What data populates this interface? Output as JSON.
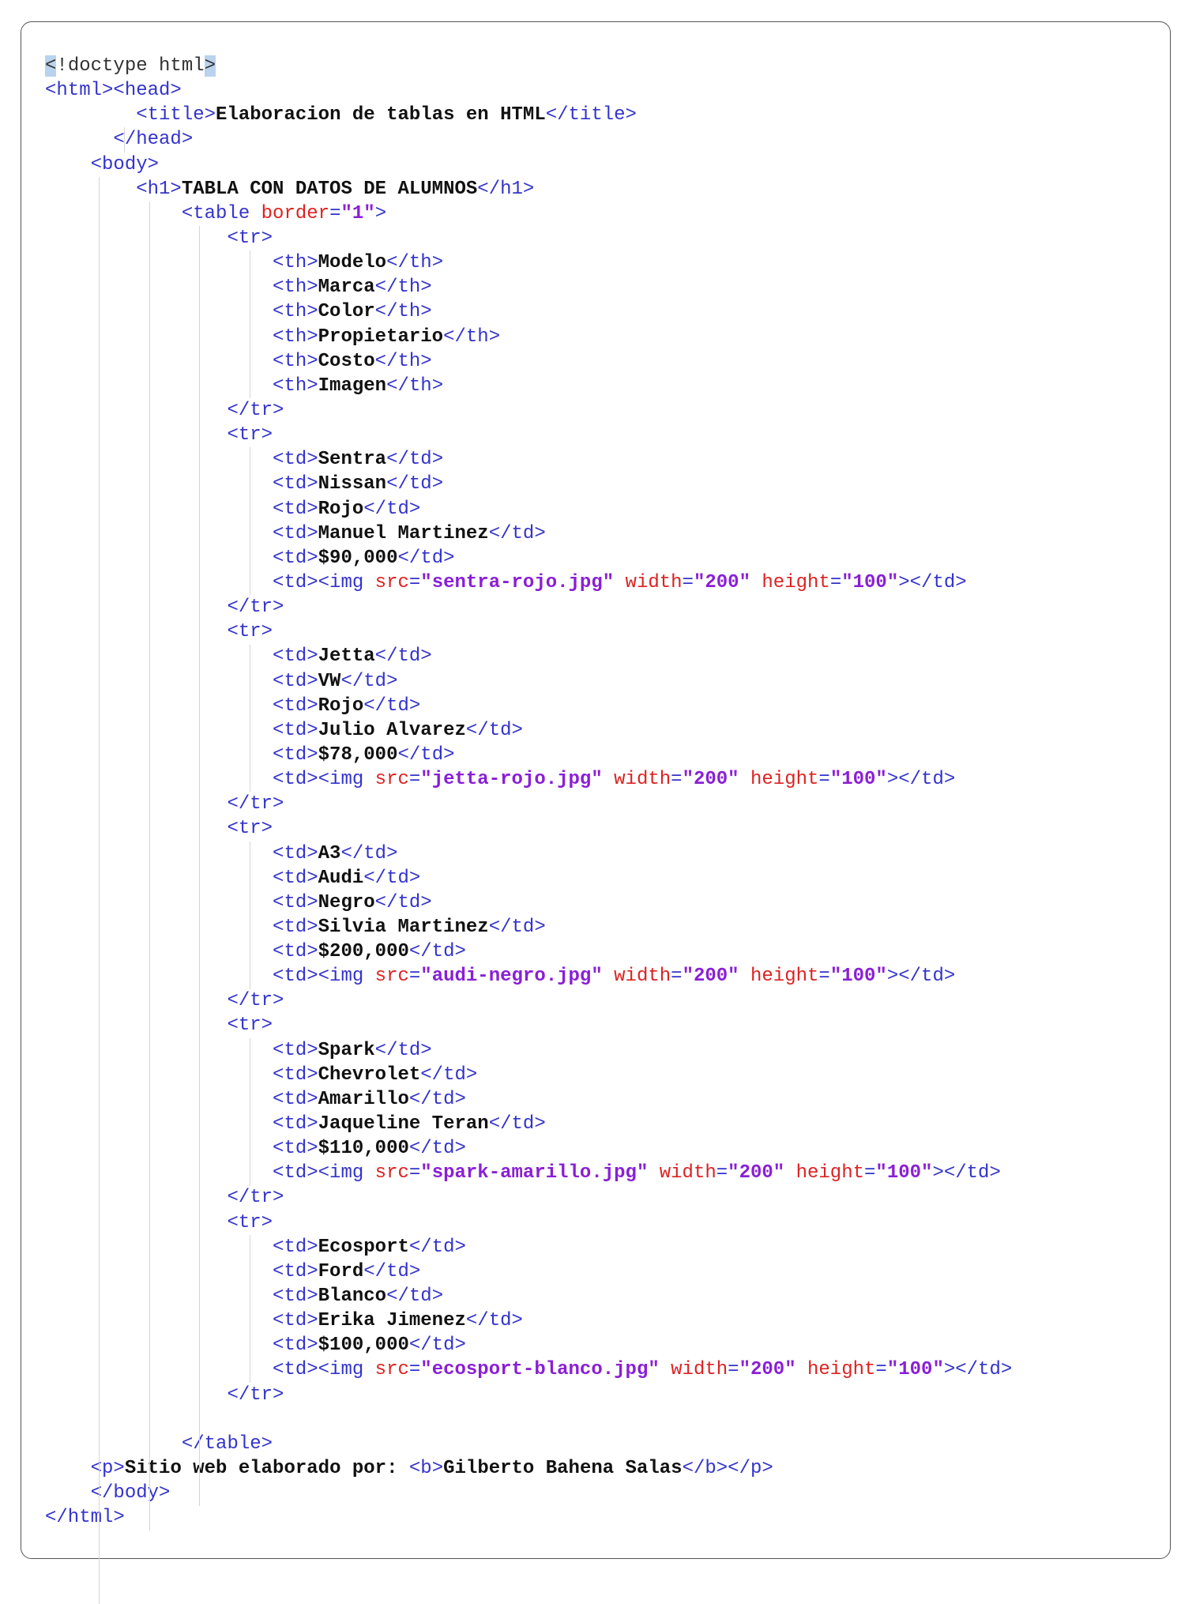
{
  "editor": {
    "lines": [
      {
        "indent": 0,
        "parts": [
          {
            "t": "<",
            "c": "hl"
          },
          {
            "t": "!",
            "c": "hl-plain"
          },
          {
            "t": "doctype html",
            "c": "plain"
          },
          {
            "t": ">",
            "c": "hl"
          }
        ]
      },
      {
        "indent": 0,
        "parts": [
          {
            "t": "<html><head>",
            "c": "tag"
          }
        ]
      },
      {
        "indent": 8,
        "parts": [
          {
            "t": "<title>",
            "c": "tag"
          },
          {
            "t": "Elaboracion de tablas en HTML",
            "c": "txt"
          },
          {
            "t": "</title>",
            "c": "tag"
          }
        ]
      },
      {
        "indent": 6,
        "parts": [
          {
            "t": "</head>",
            "c": "tag"
          }
        ]
      },
      {
        "indent": 4,
        "parts": [
          {
            "t": "<body>",
            "c": "tag"
          }
        ]
      },
      {
        "indent": 8,
        "parts": [
          {
            "t": "<h1>",
            "c": "tag"
          },
          {
            "t": "TABLA CON DATOS DE ALUMNOS",
            "c": "txt"
          },
          {
            "t": "</h1>",
            "c": "tag"
          }
        ]
      },
      {
        "indent": 12,
        "parts": [
          {
            "t": "<table ",
            "c": "tag"
          },
          {
            "t": "border",
            "c": "attr"
          },
          {
            "t": "=",
            "c": "tag"
          },
          {
            "t": "\"1\"",
            "c": "val"
          },
          {
            "t": ">",
            "c": "tag"
          }
        ]
      },
      {
        "indent": 16,
        "parts": [
          {
            "t": "<tr>",
            "c": "tag"
          }
        ]
      },
      {
        "indent": 20,
        "parts": [
          {
            "t": "<th>",
            "c": "tag"
          },
          {
            "t": "Modelo",
            "c": "txt"
          },
          {
            "t": "</th>",
            "c": "tag"
          }
        ]
      },
      {
        "indent": 20,
        "parts": [
          {
            "t": "<th>",
            "c": "tag"
          },
          {
            "t": "Marca",
            "c": "txt"
          },
          {
            "t": "</th>",
            "c": "tag"
          }
        ]
      },
      {
        "indent": 20,
        "parts": [
          {
            "t": "<th>",
            "c": "tag"
          },
          {
            "t": "Color",
            "c": "txt"
          },
          {
            "t": "</th>",
            "c": "tag"
          }
        ]
      },
      {
        "indent": 20,
        "parts": [
          {
            "t": "<th>",
            "c": "tag"
          },
          {
            "t": "Propietario",
            "c": "txt"
          },
          {
            "t": "</th>",
            "c": "tag"
          }
        ]
      },
      {
        "indent": 20,
        "parts": [
          {
            "t": "<th>",
            "c": "tag"
          },
          {
            "t": "Costo",
            "c": "txt"
          },
          {
            "t": "</th>",
            "c": "tag"
          }
        ]
      },
      {
        "indent": 20,
        "parts": [
          {
            "t": "<th>",
            "c": "tag"
          },
          {
            "t": "Imagen",
            "c": "txt"
          },
          {
            "t": "</th>",
            "c": "tag"
          }
        ]
      },
      {
        "indent": 16,
        "parts": [
          {
            "t": "</tr>",
            "c": "tag"
          }
        ]
      },
      {
        "indent": 16,
        "parts": [
          {
            "t": "<tr>",
            "c": "tag"
          }
        ]
      },
      {
        "indent": 20,
        "parts": [
          {
            "t": "<td>",
            "c": "tag"
          },
          {
            "t": "Sentra",
            "c": "txt"
          },
          {
            "t": "</td>",
            "c": "tag"
          }
        ]
      },
      {
        "indent": 20,
        "parts": [
          {
            "t": "<td>",
            "c": "tag"
          },
          {
            "t": "Nissan",
            "c": "txt"
          },
          {
            "t": "</td>",
            "c": "tag"
          }
        ]
      },
      {
        "indent": 20,
        "parts": [
          {
            "t": "<td>",
            "c": "tag"
          },
          {
            "t": "Rojo",
            "c": "txt"
          },
          {
            "t": "</td>",
            "c": "tag"
          }
        ]
      },
      {
        "indent": 20,
        "parts": [
          {
            "t": "<td>",
            "c": "tag"
          },
          {
            "t": "Manuel Martinez",
            "c": "txt"
          },
          {
            "t": "</td>",
            "c": "tag"
          }
        ]
      },
      {
        "indent": 20,
        "parts": [
          {
            "t": "<td>",
            "c": "tag"
          },
          {
            "t": "$90,000",
            "c": "txt"
          },
          {
            "t": "</td>",
            "c": "tag"
          }
        ]
      },
      {
        "indent": 20,
        "parts": [
          {
            "t": "<td><img ",
            "c": "tag"
          },
          {
            "t": "src",
            "c": "attr"
          },
          {
            "t": "=",
            "c": "tag"
          },
          {
            "t": "\"sentra-rojo.jpg\"",
            "c": "val"
          },
          {
            "t": " ",
            "c": "tag"
          },
          {
            "t": "width",
            "c": "attr"
          },
          {
            "t": "=",
            "c": "tag"
          },
          {
            "t": "\"200\"",
            "c": "val"
          },
          {
            "t": " ",
            "c": "tag"
          },
          {
            "t": "height",
            "c": "attr"
          },
          {
            "t": "=",
            "c": "tag"
          },
          {
            "t": "\"100\"",
            "c": "val"
          },
          {
            "t": "></td>",
            "c": "tag"
          }
        ]
      },
      {
        "indent": 16,
        "parts": [
          {
            "t": "</tr>",
            "c": "tag"
          }
        ]
      },
      {
        "indent": 16,
        "parts": [
          {
            "t": "<tr>",
            "c": "tag"
          }
        ]
      },
      {
        "indent": 20,
        "parts": [
          {
            "t": "<td>",
            "c": "tag"
          },
          {
            "t": "Jetta",
            "c": "txt"
          },
          {
            "t": "</td>",
            "c": "tag"
          }
        ]
      },
      {
        "indent": 20,
        "parts": [
          {
            "t": "<td>",
            "c": "tag"
          },
          {
            "t": "VW",
            "c": "txt"
          },
          {
            "t": "</td>",
            "c": "tag"
          }
        ]
      },
      {
        "indent": 20,
        "parts": [
          {
            "t": "<td>",
            "c": "tag"
          },
          {
            "t": "Rojo",
            "c": "txt"
          },
          {
            "t": "</td>",
            "c": "tag"
          }
        ]
      },
      {
        "indent": 20,
        "parts": [
          {
            "t": "<td>",
            "c": "tag"
          },
          {
            "t": "Julio Alvarez",
            "c": "txt"
          },
          {
            "t": "</td>",
            "c": "tag"
          }
        ]
      },
      {
        "indent": 20,
        "parts": [
          {
            "t": "<td>",
            "c": "tag"
          },
          {
            "t": "$78,000",
            "c": "txt"
          },
          {
            "t": "</td>",
            "c": "tag"
          }
        ]
      },
      {
        "indent": 20,
        "parts": [
          {
            "t": "<td><img ",
            "c": "tag"
          },
          {
            "t": "src",
            "c": "attr"
          },
          {
            "t": "=",
            "c": "tag"
          },
          {
            "t": "\"jetta-rojo.jpg\"",
            "c": "val"
          },
          {
            "t": " ",
            "c": "tag"
          },
          {
            "t": "width",
            "c": "attr"
          },
          {
            "t": "=",
            "c": "tag"
          },
          {
            "t": "\"200\"",
            "c": "val"
          },
          {
            "t": " ",
            "c": "tag"
          },
          {
            "t": "height",
            "c": "attr"
          },
          {
            "t": "=",
            "c": "tag"
          },
          {
            "t": "\"100\"",
            "c": "val"
          },
          {
            "t": "></td>",
            "c": "tag"
          }
        ]
      },
      {
        "indent": 16,
        "parts": [
          {
            "t": "</tr>",
            "c": "tag"
          }
        ]
      },
      {
        "indent": 16,
        "parts": [
          {
            "t": "<tr>",
            "c": "tag"
          }
        ]
      },
      {
        "indent": 20,
        "parts": [
          {
            "t": "<td>",
            "c": "tag"
          },
          {
            "t": "A3",
            "c": "txt"
          },
          {
            "t": "</td>",
            "c": "tag"
          }
        ]
      },
      {
        "indent": 20,
        "parts": [
          {
            "t": "<td>",
            "c": "tag"
          },
          {
            "t": "Audi",
            "c": "txt"
          },
          {
            "t": "</td>",
            "c": "tag"
          }
        ]
      },
      {
        "indent": 20,
        "parts": [
          {
            "t": "<td>",
            "c": "tag"
          },
          {
            "t": "Negro",
            "c": "txt"
          },
          {
            "t": "</td>",
            "c": "tag"
          }
        ]
      },
      {
        "indent": 20,
        "parts": [
          {
            "t": "<td>",
            "c": "tag"
          },
          {
            "t": "Silvia Martinez",
            "c": "txt"
          },
          {
            "t": "</td>",
            "c": "tag"
          }
        ]
      },
      {
        "indent": 20,
        "parts": [
          {
            "t": "<td>",
            "c": "tag"
          },
          {
            "t": "$200,000",
            "c": "txt"
          },
          {
            "t": "</td>",
            "c": "tag"
          }
        ]
      },
      {
        "indent": 20,
        "parts": [
          {
            "t": "<td><img ",
            "c": "tag"
          },
          {
            "t": "src",
            "c": "attr"
          },
          {
            "t": "=",
            "c": "tag"
          },
          {
            "t": "\"audi-negro.jpg\"",
            "c": "val"
          },
          {
            "t": " ",
            "c": "tag"
          },
          {
            "t": "width",
            "c": "attr"
          },
          {
            "t": "=",
            "c": "tag"
          },
          {
            "t": "\"200\"",
            "c": "val"
          },
          {
            "t": " ",
            "c": "tag"
          },
          {
            "t": "height",
            "c": "attr"
          },
          {
            "t": "=",
            "c": "tag"
          },
          {
            "t": "\"100\"",
            "c": "val"
          },
          {
            "t": "></td>",
            "c": "tag"
          }
        ]
      },
      {
        "indent": 16,
        "parts": [
          {
            "t": "</tr>",
            "c": "tag"
          }
        ]
      },
      {
        "indent": 16,
        "parts": [
          {
            "t": "<tr>",
            "c": "tag"
          }
        ]
      },
      {
        "indent": 20,
        "parts": [
          {
            "t": "<td>",
            "c": "tag"
          },
          {
            "t": "Spark",
            "c": "txt"
          },
          {
            "t": "</td>",
            "c": "tag"
          }
        ]
      },
      {
        "indent": 20,
        "parts": [
          {
            "t": "<td>",
            "c": "tag"
          },
          {
            "t": "Chevrolet",
            "c": "txt"
          },
          {
            "t": "</td>",
            "c": "tag"
          }
        ]
      },
      {
        "indent": 20,
        "parts": [
          {
            "t": "<td>",
            "c": "tag"
          },
          {
            "t": "Amarillo",
            "c": "txt"
          },
          {
            "t": "</td>",
            "c": "tag"
          }
        ]
      },
      {
        "indent": 20,
        "parts": [
          {
            "t": "<td>",
            "c": "tag"
          },
          {
            "t": "Jaqueline Teran",
            "c": "txt"
          },
          {
            "t": "</td>",
            "c": "tag"
          }
        ]
      },
      {
        "indent": 20,
        "parts": [
          {
            "t": "<td>",
            "c": "tag"
          },
          {
            "t": "$110,000",
            "c": "txt"
          },
          {
            "t": "</td>",
            "c": "tag"
          }
        ]
      },
      {
        "indent": 20,
        "parts": [
          {
            "t": "<td><img ",
            "c": "tag"
          },
          {
            "t": "src",
            "c": "attr"
          },
          {
            "t": "=",
            "c": "tag"
          },
          {
            "t": "\"spark-amarillo.jpg\"",
            "c": "val"
          },
          {
            "t": " ",
            "c": "tag"
          },
          {
            "t": "width",
            "c": "attr"
          },
          {
            "t": "=",
            "c": "tag"
          },
          {
            "t": "\"200\"",
            "c": "val"
          },
          {
            "t": " ",
            "c": "tag"
          },
          {
            "t": "height",
            "c": "attr"
          },
          {
            "t": "=",
            "c": "tag"
          },
          {
            "t": "\"100\"",
            "c": "val"
          },
          {
            "t": "></td>",
            "c": "tag"
          }
        ]
      },
      {
        "indent": 16,
        "parts": [
          {
            "t": "</tr>",
            "c": "tag"
          }
        ]
      },
      {
        "indent": 16,
        "parts": [
          {
            "t": "<tr>",
            "c": "tag"
          }
        ]
      },
      {
        "indent": 20,
        "parts": [
          {
            "t": "<td>",
            "c": "tag"
          },
          {
            "t": "Ecosport",
            "c": "txt"
          },
          {
            "t": "</td>",
            "c": "tag"
          }
        ]
      },
      {
        "indent": 20,
        "parts": [
          {
            "t": "<td>",
            "c": "tag"
          },
          {
            "t": "Ford",
            "c": "txt"
          },
          {
            "t": "</td>",
            "c": "tag"
          }
        ]
      },
      {
        "indent": 20,
        "parts": [
          {
            "t": "<td>",
            "c": "tag"
          },
          {
            "t": "Blanco",
            "c": "txt"
          },
          {
            "t": "</td>",
            "c": "tag"
          }
        ]
      },
      {
        "indent": 20,
        "parts": [
          {
            "t": "<td>",
            "c": "tag"
          },
          {
            "t": "Erika Jimenez",
            "c": "txt"
          },
          {
            "t": "</td>",
            "c": "tag"
          }
        ]
      },
      {
        "indent": 20,
        "parts": [
          {
            "t": "<td>",
            "c": "tag"
          },
          {
            "t": "$100,000",
            "c": "txt"
          },
          {
            "t": "</td>",
            "c": "tag"
          }
        ]
      },
      {
        "indent": 20,
        "parts": [
          {
            "t": "<td><img ",
            "c": "tag"
          },
          {
            "t": "src",
            "c": "attr"
          },
          {
            "t": "=",
            "c": "tag"
          },
          {
            "t": "\"ecosport-blanco.jpg\"",
            "c": "val"
          },
          {
            "t": " ",
            "c": "tag"
          },
          {
            "t": "width",
            "c": "attr"
          },
          {
            "t": "=",
            "c": "tag"
          },
          {
            "t": "\"200\"",
            "c": "val"
          },
          {
            "t": " ",
            "c": "tag"
          },
          {
            "t": "height",
            "c": "attr"
          },
          {
            "t": "=",
            "c": "tag"
          },
          {
            "t": "\"100\"",
            "c": "val"
          },
          {
            "t": "></td>",
            "c": "tag"
          }
        ]
      },
      {
        "indent": 16,
        "parts": [
          {
            "t": "</tr>",
            "c": "tag"
          }
        ]
      },
      {
        "indent": 0,
        "parts": []
      },
      {
        "indent": 12,
        "parts": [
          {
            "t": "</table>",
            "c": "tag"
          }
        ]
      },
      {
        "indent": 4,
        "parts": [
          {
            "t": "<p>",
            "c": "tag"
          },
          {
            "t": "Sitio web elaborado por: ",
            "c": "txt"
          },
          {
            "t": "<b>",
            "c": "tag"
          },
          {
            "t": "Gilberto Bahena Salas",
            "c": "txt"
          },
          {
            "t": "</b></p>",
            "c": "tag"
          }
        ]
      },
      {
        "indent": 4,
        "parts": [
          {
            "t": "</body>",
            "c": "tag"
          }
        ]
      },
      {
        "indent": 0,
        "parts": [
          {
            "t": "</html>",
            "c": "tag"
          }
        ]
      }
    ]
  },
  "colors": {
    "tag": "#3333cc",
    "attribute": "#dd2222",
    "value": "#8a1fd6",
    "text": "#111111",
    "selection": "#b9d3ee"
  }
}
